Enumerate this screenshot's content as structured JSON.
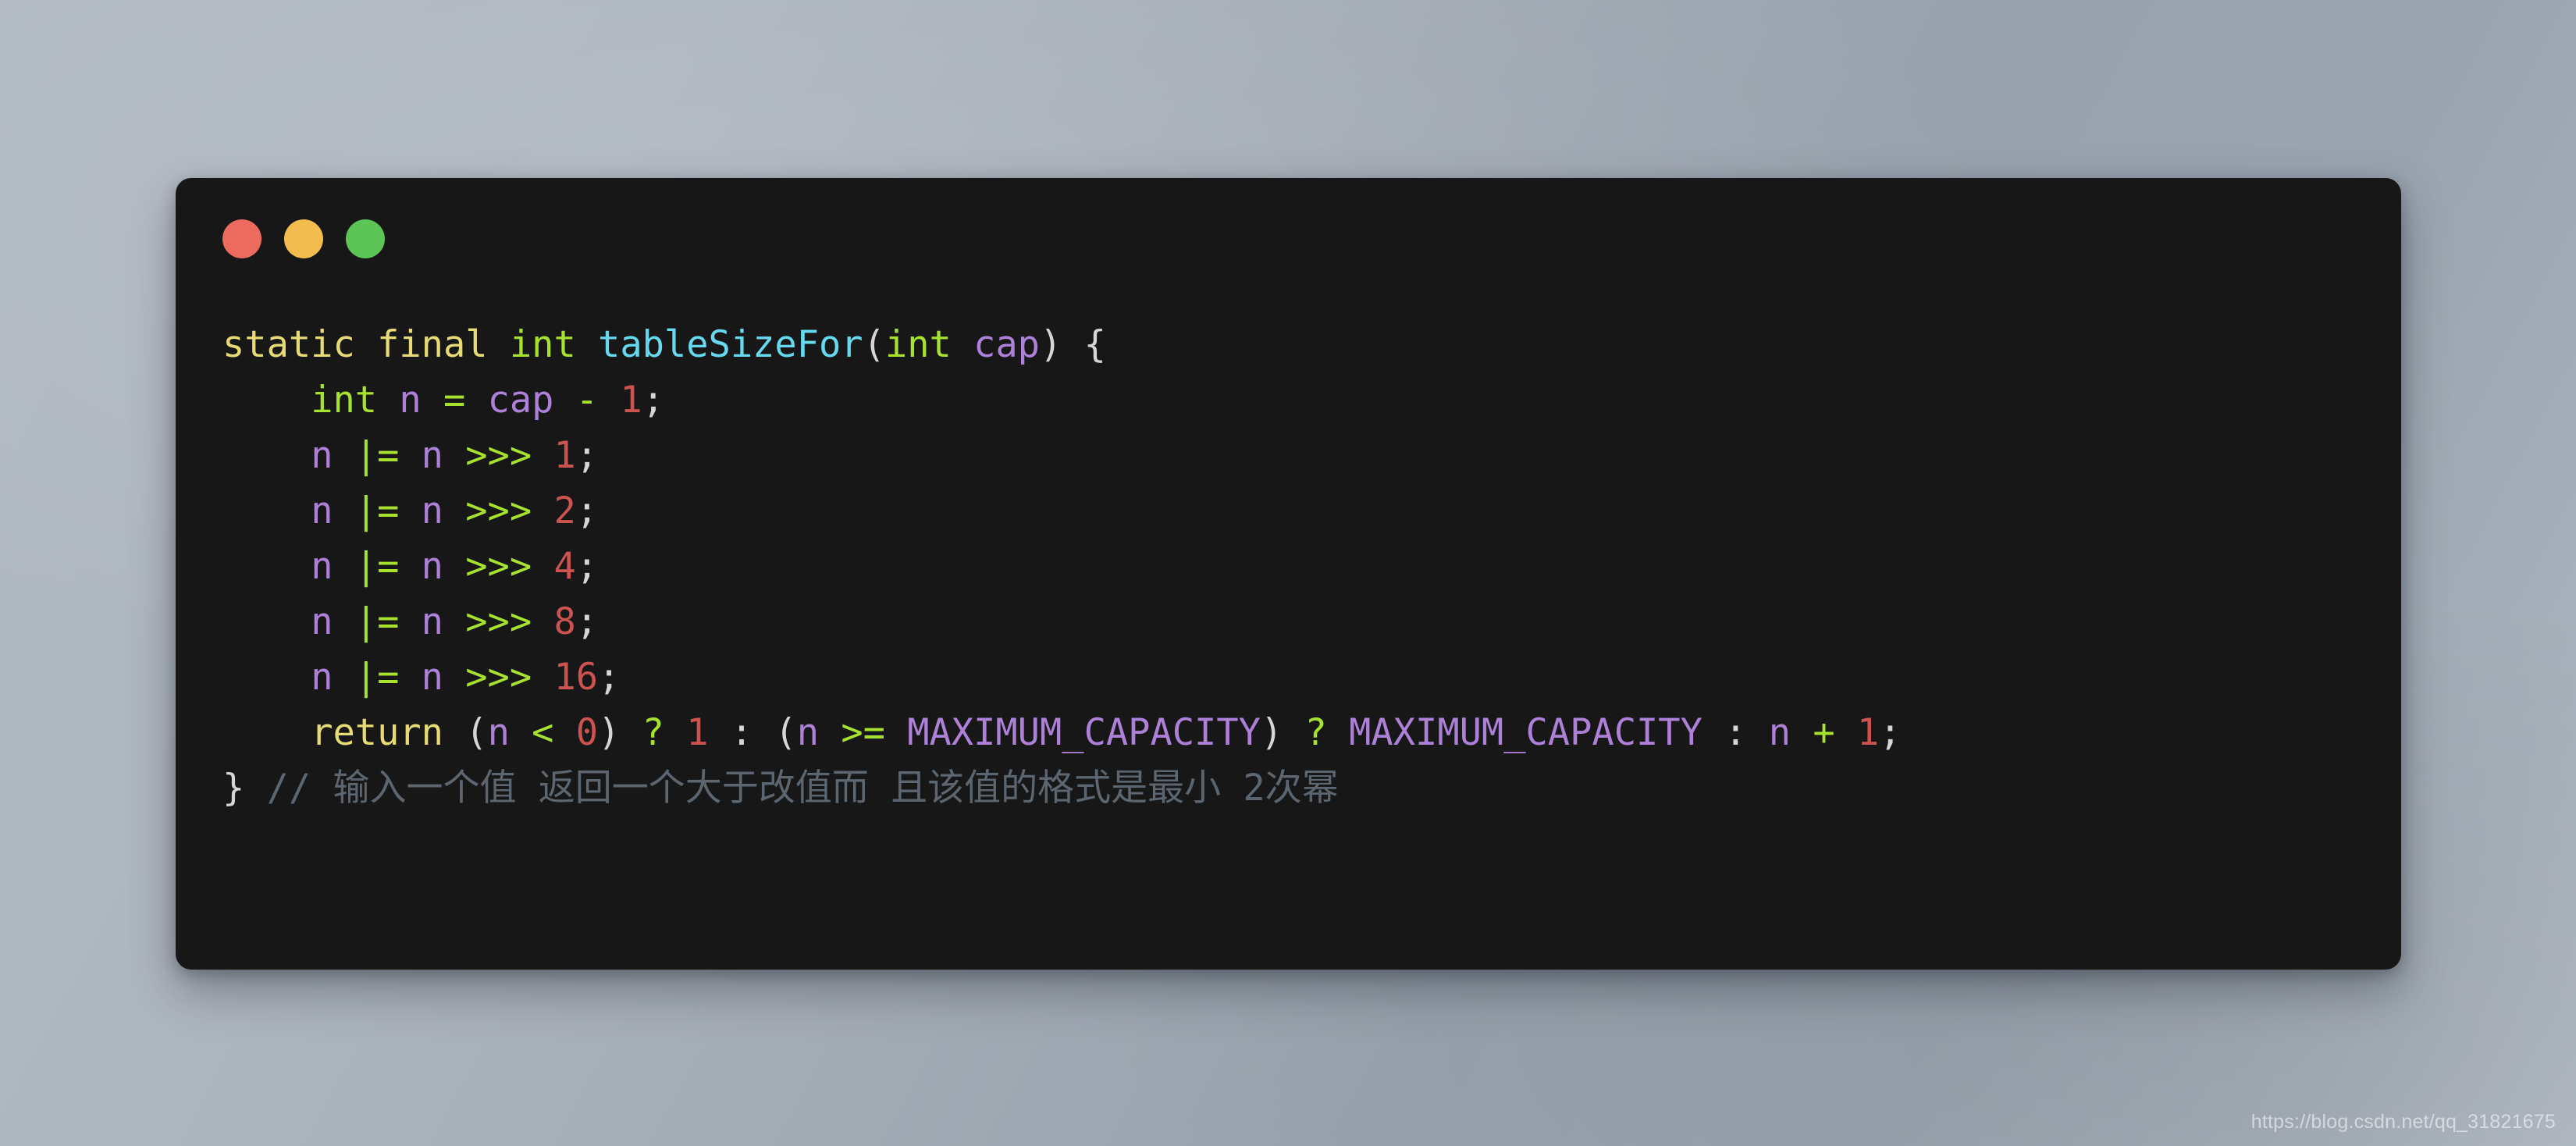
{
  "window": {
    "name": "code-snippet-window",
    "background_color": "#171717",
    "corner_radius_px": 20,
    "traffic_lights": [
      {
        "name": "close",
        "label": "Close",
        "color": "#ec6a5e"
      },
      {
        "name": "minimize",
        "label": "Minimize",
        "color": "#f3bc4f"
      },
      {
        "name": "maximize",
        "label": "Maximize",
        "color": "#5dc555"
      }
    ]
  },
  "desktop": {
    "background_color_top_left": "#b2bac3",
    "background_color_center": "#98a2ad",
    "background_color_bottom_right": "#b4bcc5"
  },
  "code": {
    "language": "java",
    "theme_colors": {
      "keyword": "#e6db74",
      "type": "#a6e22e",
      "function": "#66d9ef",
      "variable": "#ae81d8",
      "operator": "#a6e22e",
      "number": "#cc5350",
      "punctuation": "#d6d6d6",
      "comment": "#5c6670",
      "background": "#171717"
    },
    "plain_text": "static final int tableSizeFor(int cap) {\n    int n = cap - 1;\n    n |= n >>> 1;\n    n |= n >>> 2;\n    n |= n >>> 4;\n    n |= n >>> 8;\n    n |= n >>> 16;\n    return (n < 0) ? 1 : (n >= MAXIMUM_CAPACITY) ? MAXIMUM_CAPACITY : n + 1;\n} // 输入一个值 返回一个大于改值而 且该值的格式是最小 2次幂",
    "lines": [
      {
        "number": 1,
        "indent": "",
        "tokens": [
          {
            "t": "static final",
            "c": "keyword"
          },
          {
            "t": " ",
            "c": "plain"
          },
          {
            "t": "int",
            "c": "type"
          },
          {
            "t": " ",
            "c": "plain"
          },
          {
            "t": "tableSizeFor",
            "c": "function"
          },
          {
            "t": "(",
            "c": "punctuation"
          },
          {
            "t": "int",
            "c": "type"
          },
          {
            "t": " ",
            "c": "plain"
          },
          {
            "t": "cap",
            "c": "variable"
          },
          {
            "t": ")",
            "c": "punctuation"
          },
          {
            "t": " ",
            "c": "plain"
          },
          {
            "t": "{",
            "c": "punctuation"
          }
        ]
      },
      {
        "number": 2,
        "indent": "    ",
        "tokens": [
          {
            "t": "int",
            "c": "type"
          },
          {
            "t": " ",
            "c": "plain"
          },
          {
            "t": "n",
            "c": "variable"
          },
          {
            "t": " ",
            "c": "plain"
          },
          {
            "t": "=",
            "c": "operator"
          },
          {
            "t": " ",
            "c": "plain"
          },
          {
            "t": "cap",
            "c": "variable"
          },
          {
            "t": " ",
            "c": "plain"
          },
          {
            "t": "-",
            "c": "operator"
          },
          {
            "t": " ",
            "c": "plain"
          },
          {
            "t": "1",
            "c": "number"
          },
          {
            "t": ";",
            "c": "punctuation"
          }
        ]
      },
      {
        "number": 3,
        "indent": "    ",
        "tokens": [
          {
            "t": "n",
            "c": "variable"
          },
          {
            "t": " ",
            "c": "plain"
          },
          {
            "t": "|=",
            "c": "operator"
          },
          {
            "t": " ",
            "c": "plain"
          },
          {
            "t": "n",
            "c": "variable"
          },
          {
            "t": " ",
            "c": "plain"
          },
          {
            "t": ">>>",
            "c": "operator"
          },
          {
            "t": " ",
            "c": "plain"
          },
          {
            "t": "1",
            "c": "number"
          },
          {
            "t": ";",
            "c": "punctuation"
          }
        ]
      },
      {
        "number": 4,
        "indent": "    ",
        "tokens": [
          {
            "t": "n",
            "c": "variable"
          },
          {
            "t": " ",
            "c": "plain"
          },
          {
            "t": "|=",
            "c": "operator"
          },
          {
            "t": " ",
            "c": "plain"
          },
          {
            "t": "n",
            "c": "variable"
          },
          {
            "t": " ",
            "c": "plain"
          },
          {
            "t": ">>>",
            "c": "operator"
          },
          {
            "t": " ",
            "c": "plain"
          },
          {
            "t": "2",
            "c": "number"
          },
          {
            "t": ";",
            "c": "punctuation"
          }
        ]
      },
      {
        "number": 5,
        "indent": "    ",
        "tokens": [
          {
            "t": "n",
            "c": "variable"
          },
          {
            "t": " ",
            "c": "plain"
          },
          {
            "t": "|=",
            "c": "operator"
          },
          {
            "t": " ",
            "c": "plain"
          },
          {
            "t": "n",
            "c": "variable"
          },
          {
            "t": " ",
            "c": "plain"
          },
          {
            "t": ">>>",
            "c": "operator"
          },
          {
            "t": " ",
            "c": "plain"
          },
          {
            "t": "4",
            "c": "number"
          },
          {
            "t": ";",
            "c": "punctuation"
          }
        ]
      },
      {
        "number": 6,
        "indent": "    ",
        "tokens": [
          {
            "t": "n",
            "c": "variable"
          },
          {
            "t": " ",
            "c": "plain"
          },
          {
            "t": "|=",
            "c": "operator"
          },
          {
            "t": " ",
            "c": "plain"
          },
          {
            "t": "n",
            "c": "variable"
          },
          {
            "t": " ",
            "c": "plain"
          },
          {
            "t": ">>>",
            "c": "operator"
          },
          {
            "t": " ",
            "c": "plain"
          },
          {
            "t": "8",
            "c": "number"
          },
          {
            "t": ";",
            "c": "punctuation"
          }
        ]
      },
      {
        "number": 7,
        "indent": "    ",
        "tokens": [
          {
            "t": "n",
            "c": "variable"
          },
          {
            "t": " ",
            "c": "plain"
          },
          {
            "t": "|=",
            "c": "operator"
          },
          {
            "t": " ",
            "c": "plain"
          },
          {
            "t": "n",
            "c": "variable"
          },
          {
            "t": " ",
            "c": "plain"
          },
          {
            "t": ">>>",
            "c": "operator"
          },
          {
            "t": " ",
            "c": "plain"
          },
          {
            "t": "16",
            "c": "number"
          },
          {
            "t": ";",
            "c": "punctuation"
          }
        ]
      },
      {
        "number": 8,
        "indent": "    ",
        "tokens": [
          {
            "t": "return",
            "c": "keyword"
          },
          {
            "t": " ",
            "c": "plain"
          },
          {
            "t": "(",
            "c": "punctuation"
          },
          {
            "t": "n",
            "c": "variable"
          },
          {
            "t": " ",
            "c": "plain"
          },
          {
            "t": "<",
            "c": "operator"
          },
          {
            "t": " ",
            "c": "plain"
          },
          {
            "t": "0",
            "c": "number"
          },
          {
            "t": ")",
            "c": "punctuation"
          },
          {
            "t": " ",
            "c": "plain"
          },
          {
            "t": "?",
            "c": "operator"
          },
          {
            "t": " ",
            "c": "plain"
          },
          {
            "t": "1",
            "c": "number"
          },
          {
            "t": " ",
            "c": "plain"
          },
          {
            "t": ":",
            "c": "punctuation"
          },
          {
            "t": " ",
            "c": "plain"
          },
          {
            "t": "(",
            "c": "punctuation"
          },
          {
            "t": "n",
            "c": "variable"
          },
          {
            "t": " ",
            "c": "plain"
          },
          {
            "t": ">=",
            "c": "operator"
          },
          {
            "t": " ",
            "c": "plain"
          },
          {
            "t": "MAXIMUM_CAPACITY",
            "c": "variable"
          },
          {
            "t": ")",
            "c": "punctuation"
          },
          {
            "t": " ",
            "c": "plain"
          },
          {
            "t": "?",
            "c": "operator"
          },
          {
            "t": " ",
            "c": "plain"
          },
          {
            "t": "MAXIMUM_CAPACITY",
            "c": "variable"
          },
          {
            "t": " ",
            "c": "plain"
          },
          {
            "t": ":",
            "c": "punctuation"
          },
          {
            "t": " ",
            "c": "plain"
          },
          {
            "t": "n",
            "c": "variable"
          },
          {
            "t": " ",
            "c": "plain"
          },
          {
            "t": "+",
            "c": "operator"
          },
          {
            "t": " ",
            "c": "plain"
          },
          {
            "t": "1",
            "c": "number"
          },
          {
            "t": ";",
            "c": "punctuation"
          }
        ]
      },
      {
        "number": 9,
        "indent": "",
        "tokens": [
          {
            "t": "}",
            "c": "punctuation"
          },
          {
            "t": " ",
            "c": "plain"
          },
          {
            "t": "// 输入一个值 返回一个大于改值而 且该值的格式是最小 2次幂",
            "c": "comment"
          }
        ]
      }
    ]
  },
  "watermark": {
    "text": "https://blog.csdn.net/qq_31821675"
  }
}
